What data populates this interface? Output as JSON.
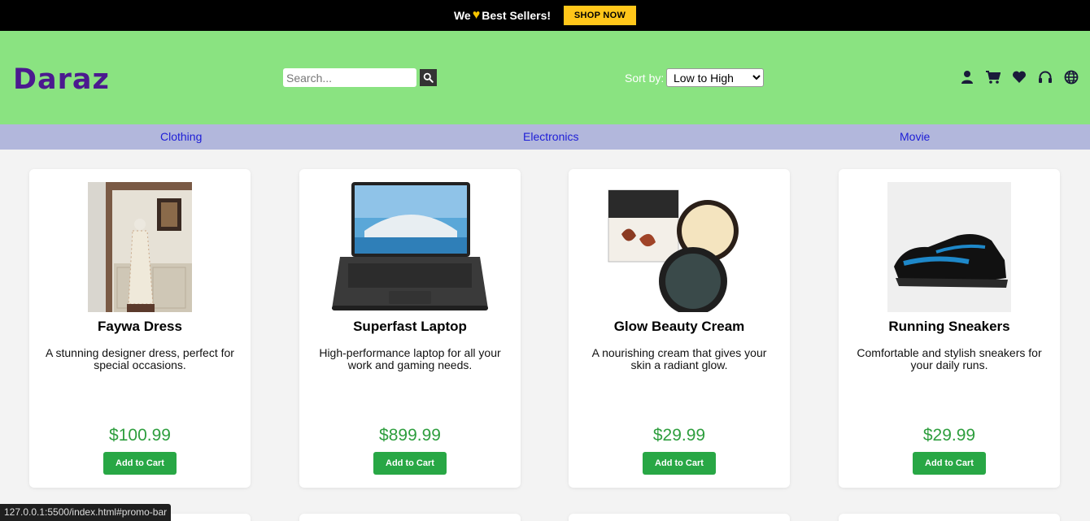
{
  "promo": {
    "text": "We",
    "text2": "Best Sellers!",
    "button": "SHOP NOW"
  },
  "header": {
    "logo": "Daraz",
    "search_placeholder": "Search...",
    "sort_label": "Sort by:",
    "sort_value": "Low to High",
    "icons": [
      "user-icon",
      "cart-icon",
      "heart-icon",
      "headset-icon",
      "globe-icon"
    ]
  },
  "nav": [
    "Clothing",
    "Electronics",
    "Movie"
  ],
  "products": [
    {
      "name": "Faywa Dress",
      "description": "A stunning designer dress, perfect for special occasions.",
      "price": "$100.99",
      "button": "Add to Cart"
    },
    {
      "name": "Superfast Laptop",
      "description": "High-performance laptop for all your work and gaming needs.",
      "price": "$899.99",
      "button": "Add to Cart"
    },
    {
      "name": "Glow Beauty Cream",
      "description": "A nourishing cream that gives your skin a radiant glow.",
      "price": "$29.99",
      "button": "Add to Cart"
    },
    {
      "name": "Running Sneakers",
      "description": "Comfortable and stylish sneakers for your daily runs.",
      "price": "$29.99",
      "button": "Add to Cart"
    }
  ],
  "status_url": "127.0.0.1:5500/index.html#promo-bar",
  "colors": {
    "promo_bg": "#000000",
    "header_bg": "#8ae381",
    "nav_bg": "#b2b7dc",
    "logo": "#4b1a8f",
    "price": "#2e9e3e",
    "button": "#28a745",
    "shop_btn": "#ffc61a"
  }
}
